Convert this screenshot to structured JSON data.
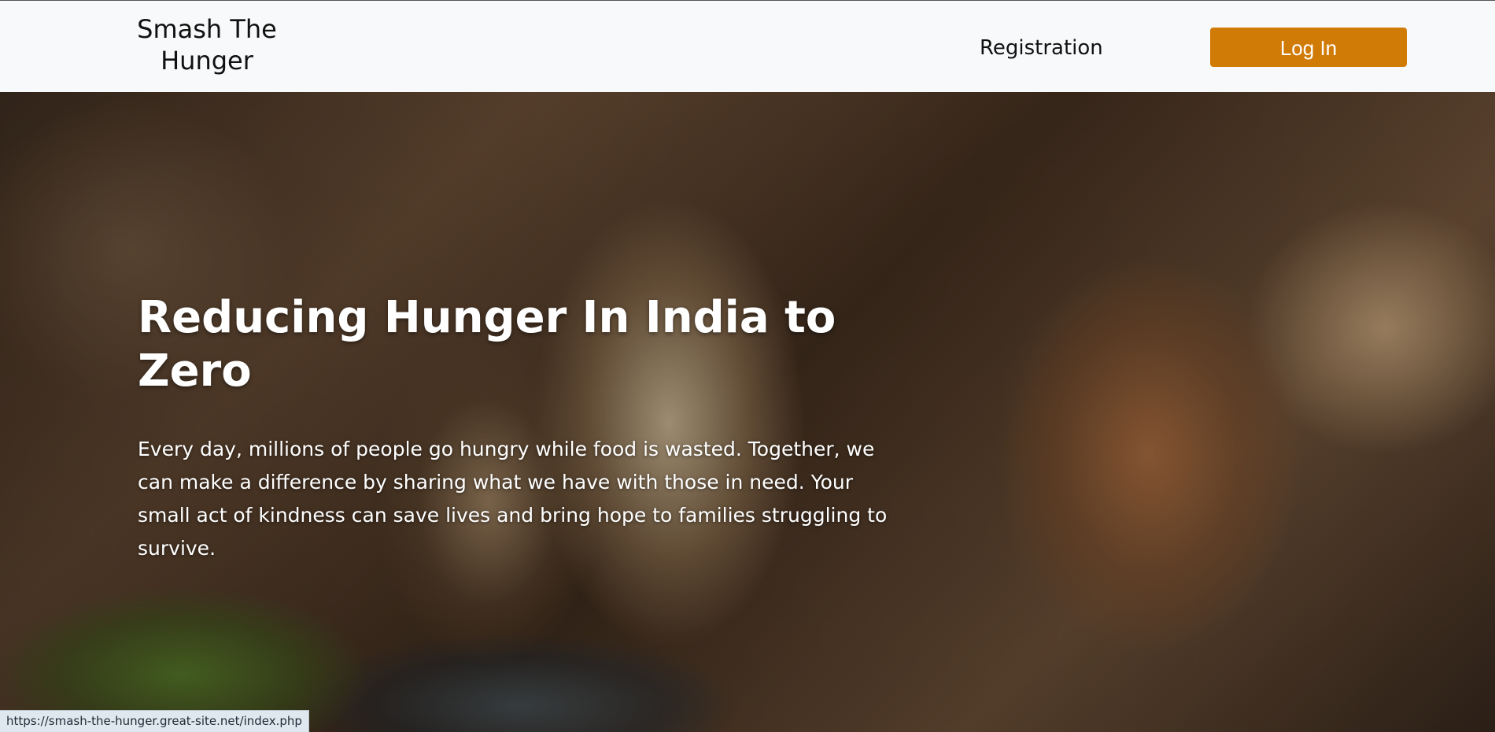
{
  "navbar": {
    "brand": "Smash The Hunger",
    "registration_label": "Registration",
    "login_label": "Log In"
  },
  "hero": {
    "title": "Reducing Hunger In India to Zero",
    "description": "Every day, millions of people go hungry while food is wasted. Together, we can make a difference by sharing what we have with those in need. Your small act of kindness can save lives and bring hope to families struggling to survive."
  },
  "status_bar": {
    "url": "https://smash-the-hunger.great-site.net/index.php"
  },
  "colors": {
    "navbar_bg": "#f8f9fa",
    "login_button": "#d17b07",
    "hero_text": "#ffffff"
  }
}
